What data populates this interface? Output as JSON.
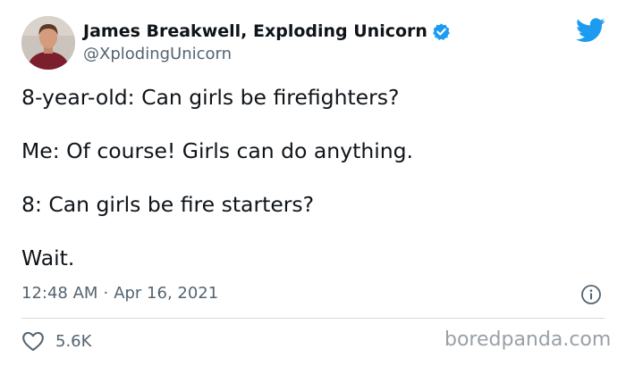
{
  "author": {
    "name": "James Breakwell, Exploding Unicorn",
    "handle": "@XplodingUnicorn",
    "verified": true
  },
  "tweet": {
    "lines": [
      "8-year-old: Can girls be firefighters?",
      "Me: Of course! Girls can do anything.",
      "8: Can girls be fire starters?",
      "Wait."
    ],
    "time": "12:48 AM",
    "separator": "·",
    "date": "Apr 16, 2021"
  },
  "actions": {
    "likes": "5.6K"
  },
  "watermark": "boredpanda.com",
  "icons": {
    "verified": "verified-badge-icon",
    "brand": "twitter-bird-icon",
    "info": "info-icon",
    "like": "heart-icon"
  },
  "colors": {
    "twitter_blue": "#1d9bf0",
    "text": "#0f1419",
    "secondary_text": "#536471",
    "divider": "#cfd9de",
    "watermark": "#9aa0a6"
  }
}
